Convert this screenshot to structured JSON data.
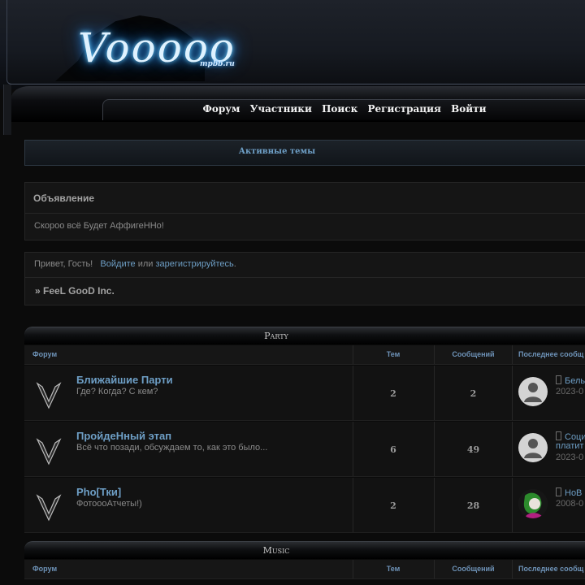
{
  "header": {
    "logo_text": "Vooooo",
    "logo_sub": "mpbb.ru"
  },
  "nav": {
    "items": [
      "Форум",
      "Участники",
      "Поиск",
      "Регистрация",
      "Войти"
    ]
  },
  "active_topics": {
    "label": "Активные темы"
  },
  "announcement": {
    "title": "Объявление",
    "text": "Скорoo всё Будет АффигеННо!"
  },
  "welcome": {
    "greeting": "Привет, Гость!",
    "login": "Войдите",
    "or": "или",
    "register": "зарегистрируйтесь",
    "forum_name": "» FeeL GooD Inc."
  },
  "columns": {
    "forum": "Форум",
    "topics": "Тем",
    "posts": "Сообщений",
    "last": "Последнее сообщ"
  },
  "categories": [
    {
      "title": "Party",
      "forums": [
        {
          "title": "Ближайшие Парти",
          "desc": "Где? Когда? С кем?",
          "topics": "2",
          "posts": "2",
          "last_title": "Бель",
          "last_title_2": "",
          "last_date": "2023-0"
        },
        {
          "title": "ПройдеНный этап",
          "desc": "Всё что позади, обсуждаем то, как это было...",
          "topics": "6",
          "posts": "49",
          "last_title": "Соци",
          "last_title_2": "платит",
          "last_date": "2023-0"
        },
        {
          "title": "Pho[Тки]",
          "desc": "ФотоooАтчеты!)",
          "topics": "2",
          "posts": "28",
          "last_title": "НоВ",
          "last_title_2": "",
          "last_date": "2008-0"
        }
      ]
    },
    {
      "title": "Music",
      "forums": []
    }
  ],
  "colors": {
    "link": "#6e9fc6",
    "background": "#0b0b0b",
    "logo_glow": "#2e9bff"
  }
}
